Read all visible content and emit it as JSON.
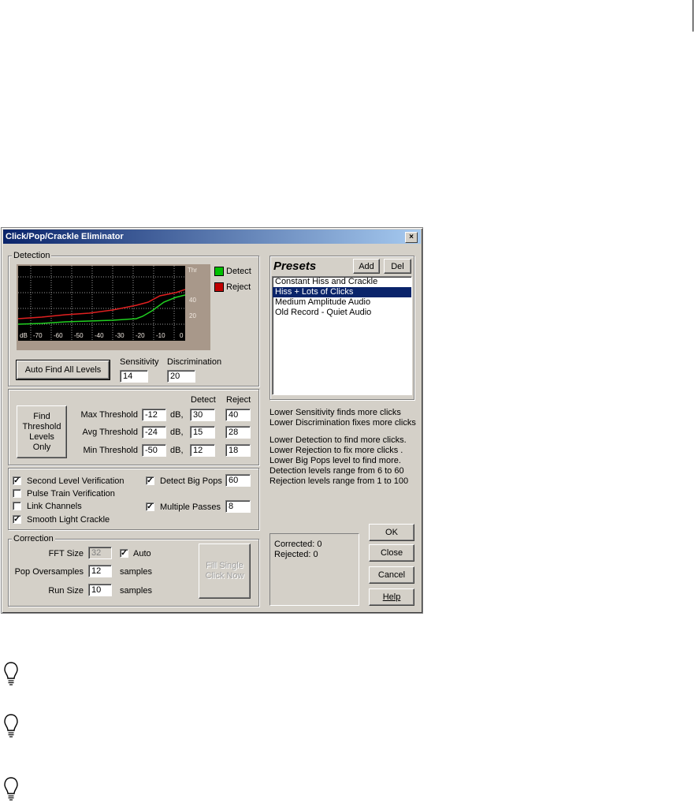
{
  "window": {
    "title": "Click/Pop/Crackle Eliminator",
    "close_glyph": "×"
  },
  "detection": {
    "group_label": "Detection",
    "graph": {
      "x_ticks": [
        "dB",
        "-70",
        "-60",
        "-50",
        "-40",
        "-30",
        "-20",
        "-10",
        "0"
      ],
      "y_ticks": [
        "Thr",
        "40",
        "20"
      ],
      "legend": [
        {
          "label": "Detect",
          "color": "#00c000"
        },
        {
          "label": "Reject",
          "color": "#c00000"
        }
      ]
    },
    "auto_find_label": "Auto Find All Levels",
    "sensitivity": {
      "label": "Sensitivity",
      "value": "14"
    },
    "discrimination": {
      "label": "Discrimination",
      "value": "20"
    }
  },
  "thresholds": {
    "find_button_label": "Find Threshold Levels Only",
    "col_detect": "Detect",
    "col_reject": "Reject",
    "unit": "dB,",
    "rows": [
      {
        "label": "Max Threshold",
        "db": "-12",
        "detect": "30",
        "reject": "40"
      },
      {
        "label": "Avg Threshold",
        "db": "-24",
        "detect": "15",
        "reject": "28"
      },
      {
        "label": "Min Threshold",
        "db": "-50",
        "detect": "12",
        "reject": "18"
      }
    ]
  },
  "options": {
    "second_level": {
      "label": "Second Level Verification",
      "checked": true
    },
    "pulse_train": {
      "label": "Pulse Train Verification",
      "checked": false
    },
    "link_channels": {
      "label": "Link Channels",
      "checked": false
    },
    "smooth_crackle": {
      "label": "Smooth Light Crackle",
      "checked": true
    },
    "detect_big_pops": {
      "label": "Detect Big Pops",
      "checked": true,
      "value": "60"
    },
    "multiple_passes": {
      "label": "Multiple Passes",
      "checked": true,
      "value": "8"
    }
  },
  "correction": {
    "group_label": "Correction",
    "fft_size": {
      "label": "FFT Size",
      "value": "32"
    },
    "auto": {
      "label": "Auto",
      "checked": true
    },
    "pop_oversamples": {
      "label": "Pop Oversamples",
      "value": "12",
      "unit": "samples"
    },
    "run_size": {
      "label": "Run Size",
      "value": "10",
      "unit": "samples"
    },
    "fill_button_label": "Fill Single Click Now"
  },
  "presets": {
    "title": "Presets",
    "add_label": "Add",
    "del_label": "Del",
    "items": [
      {
        "label": "Constant Hiss and Crackle",
        "selected": false
      },
      {
        "label": "Hiss + Lots of Clicks",
        "selected": true
      },
      {
        "label": "Medium Amplitude Audio",
        "selected": false
      },
      {
        "label": "Old Record - Quiet Audio",
        "selected": false
      }
    ]
  },
  "help_text": {
    "line1": "Lower Sensitivity finds more clicks",
    "line2": "Lower Discrimination fixes more clicks",
    "line3": "Lower Detection to find more clicks.",
    "line4": "Lower Rejection to fix more clicks .",
    "line5": "Lower Big Pops level to find more.",
    "line6": "Detection levels range from 6 to 60",
    "line7": "Rejection levels range from 1 to 100"
  },
  "status": {
    "corrected": "Corrected: 0",
    "rejected": "Rejected: 0"
  },
  "buttons": {
    "ok": "OK",
    "close": "Close",
    "cancel": "Cancel",
    "help": "Help"
  }
}
